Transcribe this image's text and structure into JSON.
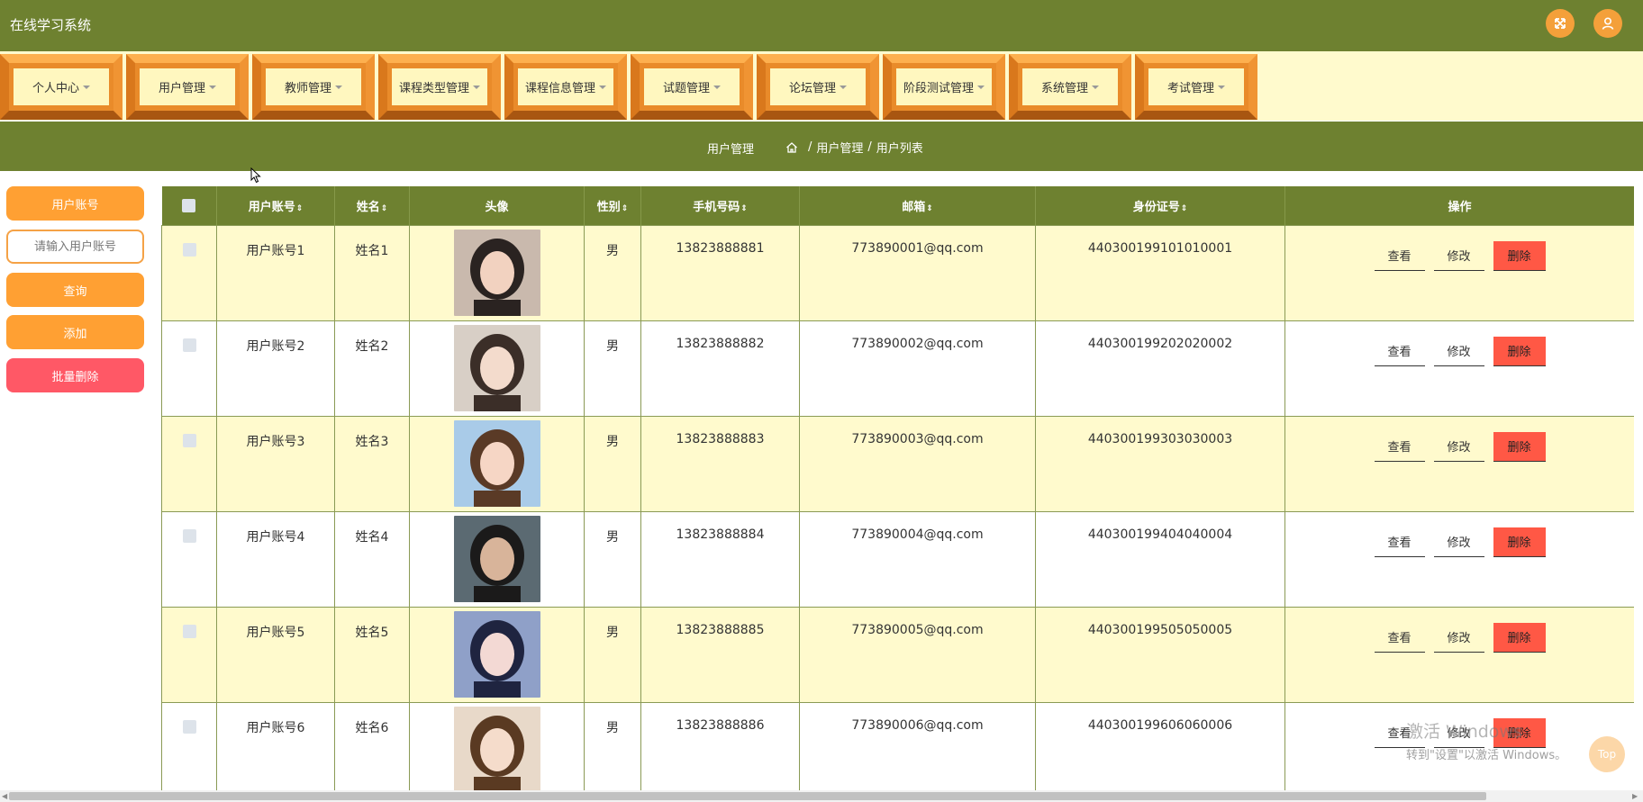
{
  "app": {
    "title": "在线学习系统"
  },
  "header": {
    "fullscreen_icon": "fullscreen-icon",
    "user_icon": "user-icon",
    "accent": "#f4a03a",
    "bg": "#6e8130"
  },
  "menu": [
    {
      "label": "个人中心"
    },
    {
      "label": "用户管理"
    },
    {
      "label": "教师管理"
    },
    {
      "label": "课程类型管理"
    },
    {
      "label": "课程信息管理"
    },
    {
      "label": "试题管理"
    },
    {
      "label": "论坛管理"
    },
    {
      "label": "阶段测试管理"
    },
    {
      "label": "系统管理"
    },
    {
      "label": "考试管理"
    }
  ],
  "breadcrumb": {
    "title": "用户管理",
    "sep": "/",
    "level1": "用户管理",
    "level2": "用户列表"
  },
  "sidebar": {
    "field_label": "用户账号",
    "search_placeholder": "请输入用户账号",
    "query_label": "查询",
    "add_label": "添加",
    "batch_delete_label": "批量删除"
  },
  "table": {
    "headers": {
      "account": "用户账号",
      "name": "姓名",
      "avatar": "头像",
      "gender": "性别",
      "phone": "手机号码",
      "email": "邮箱",
      "id_number": "身份证号",
      "actions": "操作"
    },
    "sort_glyph": "⇕",
    "actions": {
      "view": "查看",
      "edit": "修改",
      "delete": "删除"
    },
    "rows": [
      {
        "account": "用户账号1",
        "name": "姓名1",
        "gender": "男",
        "phone": "13823888881",
        "email": "773890001@qq.com",
        "id_number": "440300199101010001"
      },
      {
        "account": "用户账号2",
        "name": "姓名2",
        "gender": "男",
        "phone": "13823888882",
        "email": "773890002@qq.com",
        "id_number": "440300199202020002"
      },
      {
        "account": "用户账号3",
        "name": "姓名3",
        "gender": "男",
        "phone": "13823888883",
        "email": "773890003@qq.com",
        "id_number": "440300199303030003"
      },
      {
        "account": "用户账号4",
        "name": "姓名4",
        "gender": "男",
        "phone": "13823888884",
        "email": "773890004@qq.com",
        "id_number": "440300199404040004"
      },
      {
        "account": "用户账号5",
        "name": "姓名5",
        "gender": "男",
        "phone": "13823888885",
        "email": "773890005@qq.com",
        "id_number": "440300199505050005"
      },
      {
        "account": "用户账号6",
        "name": "姓名6",
        "gender": "男",
        "phone": "13823888886",
        "email": "773890006@qq.com",
        "id_number": "440300199606060006"
      }
    ]
  },
  "watermark": {
    "line1": "激活 Windows",
    "line2": "转到\"设置\"以激活 Windows。"
  },
  "top_button": {
    "label": "Top"
  }
}
